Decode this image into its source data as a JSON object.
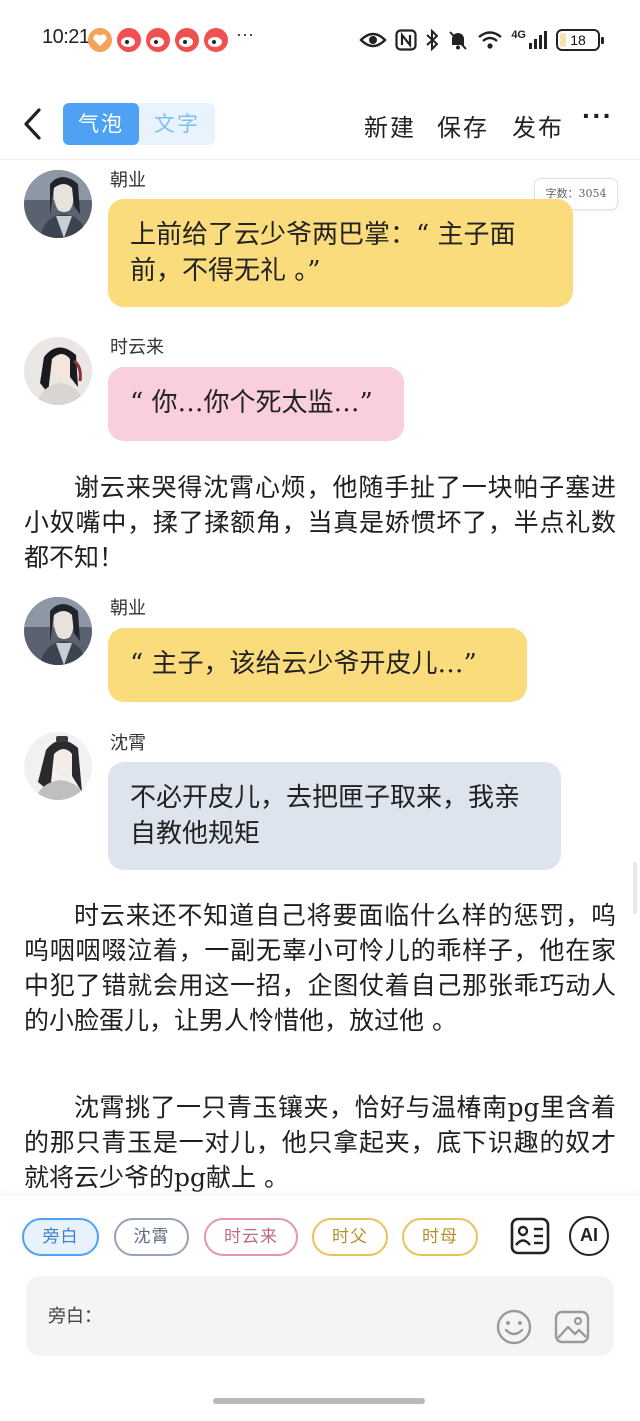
{
  "status_bar": {
    "time": "10:21",
    "more": "···",
    "network": "4G",
    "battery": "18",
    "battery_level": 0.18
  },
  "toolbar": {
    "mode_tabs": [
      "气泡",
      "文字"
    ],
    "active_tab": 0,
    "new_label": "新建",
    "save_label": "保存",
    "publish_label": "发布",
    "more_label": "···"
  },
  "word_count": "字数：3054",
  "messages": [
    {
      "speaker": "朝业",
      "text": "上前给了云少爷两巴掌：“ 主子面前，不得无礼 。”",
      "color": "#fbdc7d"
    },
    {
      "speaker": "时云来",
      "text": "“ 你…你个死太监…”",
      "color": "#f9cfdb"
    },
    {
      "speaker": "朝业",
      "text": "“ 主子，该给云少爷开皮儿…”",
      "color": "#fbdc7d"
    },
    {
      "speaker": "沈霄",
      "text": "不必开皮儿，去把匣子取来，我亲自教他规矩",
      "color": "#dde4ee"
    }
  ],
  "narration": [
    "谢云来哭得沈霄心烦，他随手扯了一块帕子塞进小奴嘴中，揉了揉额角，当真是娇惯坏了，半点礼数都不知！",
    "时云来还不知道自己将要面临什么样的惩罚，呜呜咽咽啜泣着，一副无辜小可怜儿的乖样子，他在家中犯了错就会用这一招，企图仗着自己那张乖巧动人的小脸蛋儿，让男人怜惜他，放过他 。",
    "沈霄挑了一只青玉镶夹，恰好与温椿南pg里含着的那只青玉是一对儿，他只拿起夹，底下识趣的奴才就将云少爷的pg献上 。"
  ],
  "role_chips": [
    "旁白",
    "沈霄",
    "时云来",
    "时父",
    "时母"
  ],
  "ai_label": "AI",
  "input": {
    "label": "旁白：",
    "value": ""
  }
}
